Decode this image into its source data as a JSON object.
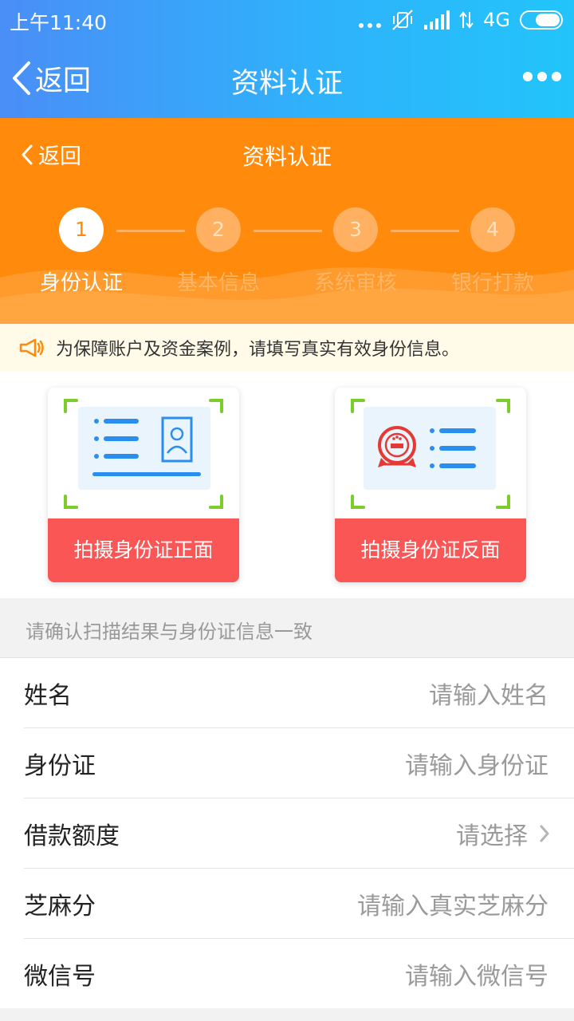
{
  "status_bar": {
    "time": "上午11:40",
    "network": "4G"
  },
  "app_bar": {
    "back_label": "返回",
    "title": "资料认证"
  },
  "sub_header": {
    "back_label": "返回",
    "title": "资料认证"
  },
  "steps": [
    {
      "number": "1",
      "label": "身份认证",
      "active": true
    },
    {
      "number": "2",
      "label": "基本信息",
      "active": false
    },
    {
      "number": "3",
      "label": "系统审核",
      "active": false
    },
    {
      "number": "4",
      "label": "银行打款",
      "active": false
    }
  ],
  "notice": {
    "text": "为保障账户及资金案例，请填写真实有效身份信息。"
  },
  "id_cards": {
    "front_button": "拍摄身份证正面",
    "back_button": "拍摄身份证反面"
  },
  "form": {
    "hint": "请确认扫描结果与身份证信息一致",
    "fields": [
      {
        "label": "姓名",
        "placeholder": "请输入姓名"
      },
      {
        "label": "身份证",
        "placeholder": "请输入身份证"
      },
      {
        "label": "借款额度",
        "placeholder": "请选择"
      },
      {
        "label": "芝麻分",
        "placeholder": "请输入真实芝麻分"
      },
      {
        "label": "微信号",
        "placeholder": "请输入微信号"
      }
    ]
  },
  "colors": {
    "primary_orange": "#ff8a0b",
    "button_red": "#fb5656",
    "blue_accent": "#2a8ef0",
    "corner_green": "#7ccd2c"
  }
}
